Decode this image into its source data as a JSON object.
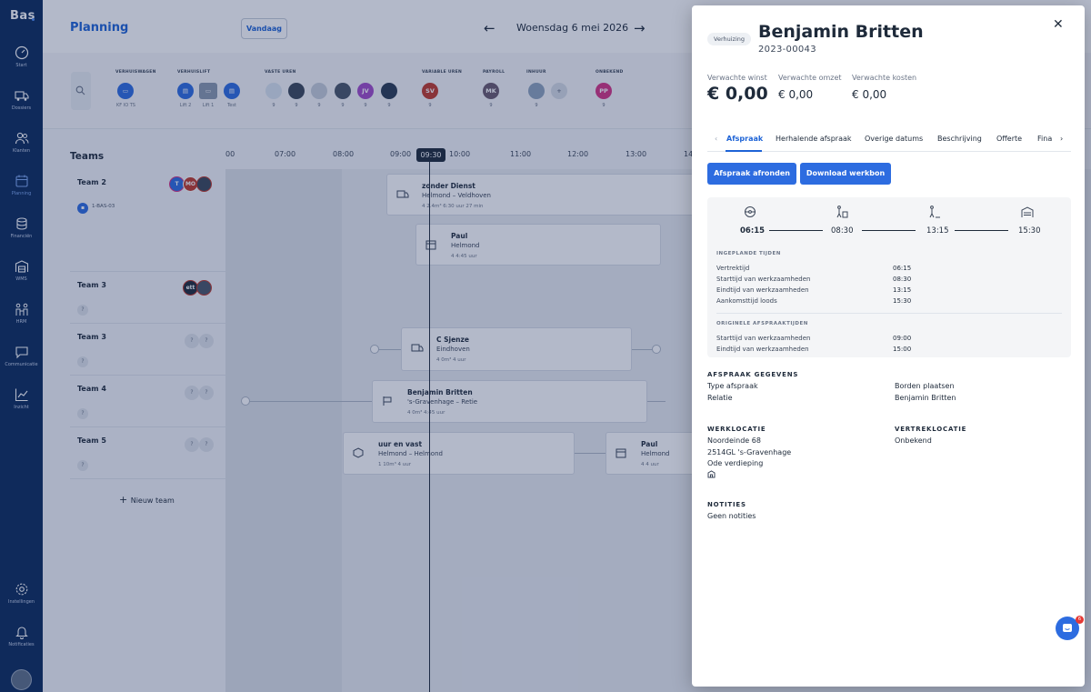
{
  "sidebar": {
    "logo": "Bas",
    "items": [
      {
        "label": "Start",
        "icon": "gauge-icon"
      },
      {
        "label": "Dossiers",
        "icon": "truck-icon"
      },
      {
        "label": "Klanten",
        "icon": "users-icon"
      },
      {
        "label": "Planning",
        "icon": "calendar-icon",
        "active": true
      },
      {
        "label": "Financiën",
        "icon": "coins-icon"
      },
      {
        "label": "WMS",
        "icon": "warehouse-icon"
      },
      {
        "label": "HRM",
        "icon": "people-icon"
      },
      {
        "label": "Communicatie",
        "icon": "chat-icon"
      },
      {
        "label": "Inzicht",
        "icon": "chart-icon"
      },
      {
        "label": "Instellingen",
        "icon": "gear-icon"
      },
      {
        "label": "Notificaties",
        "icon": "bell-icon"
      }
    ]
  },
  "header": {
    "title": "Planning",
    "today_button": "Vandaag",
    "date": "Woensdag 6 mei 2026"
  },
  "resources": {
    "groups": [
      "VERHUISWAGEN",
      "VERHUISLIFT",
      "VASTE UREN",
      "VARIABLE UREN",
      "PAYROLL",
      "INHUUR",
      "ONBEKEND"
    ],
    "items": [
      {
        "label": "KF IO TS",
        "initials": "",
        "color": "#2d6ce0"
      },
      {
        "label": "Lift 2",
        "initials": "",
        "color": "#2d6ce0"
      },
      {
        "label": "Lift 1",
        "initials": "",
        "color": "#8a98ad"
      },
      {
        "label": "Test",
        "initials": "",
        "color": "#2d6ce0"
      },
      {
        "label": "9",
        "initials": "",
        "color": "#d9e3ef"
      },
      {
        "label": "9",
        "initials": "",
        "color": "#3b4658"
      },
      {
        "label": "9",
        "initials": "",
        "color": "#c5cdd9"
      },
      {
        "label": "9",
        "initials": "",
        "color": "#4a5568"
      },
      {
        "label": "9",
        "initials": "JV",
        "color": "#a24bc8"
      },
      {
        "label": "9",
        "initials": "",
        "color": "#2b3b52"
      },
      {
        "label": "9",
        "initials": "SV",
        "color": "#c0392b"
      },
      {
        "label": "9",
        "initials": "MK",
        "color": "#6b5a6e"
      },
      {
        "label": "9",
        "initials": "",
        "color": "#8ea3bd"
      },
      {
        "label": "",
        "initials": "",
        "color": "#d5dbe4"
      },
      {
        "label": "9",
        "initials": "PP",
        "color": "#d63384"
      }
    ]
  },
  "teams": {
    "title": "Teams",
    "rows": [
      {
        "name": "Team 2",
        "tag": "1-BAS-03"
      },
      {
        "name": "Team 3",
        "tag": "?"
      },
      {
        "name": "Team 3",
        "tag": "?"
      },
      {
        "name": "Team 4",
        "tag": "?"
      },
      {
        "name": "Team 5",
        "tag": "?"
      }
    ],
    "new_team": "Nieuw team"
  },
  "timeline": {
    "ticks": [
      "00",
      "07:00",
      "08:00",
      "09:00",
      "10:00",
      "11:00",
      "12:00",
      "13:00",
      "14"
    ],
    "now": "09:30",
    "cards": [
      {
        "title": "zonder Dienst",
        "sub": "Helmond – Veldhoven",
        "meta": "4   2.4m³   6:30 uur   27 min"
      },
      {
        "title": "Paul",
        "sub": "Helmond",
        "meta": "4   4:45 uur"
      },
      {
        "title": "C Sjenze",
        "sub": "Eindhoven",
        "meta": "4   0m³   4 uur"
      },
      {
        "title": "Benjamin Britten",
        "sub": "'s-Gravenhage – Retie",
        "meta": "4   0m³   4:45 uur"
      },
      {
        "title": "uur en vast",
        "sub": "Helmond – Helmond",
        "meta": "1   10m³   4 uur"
      },
      {
        "title": "Paul",
        "sub": "Helmond",
        "meta": "4   4 uur"
      }
    ]
  },
  "panel": {
    "badge": "Verhuizing",
    "title": "Benjamin Britten",
    "subtitle": "2023-00043",
    "metrics": [
      {
        "label": "Verwachte winst",
        "value": "€ 0,00"
      },
      {
        "label": "Verwachte omzet",
        "value": "€ 0,00"
      },
      {
        "label": "Verwachte kosten",
        "value": "€ 0,00"
      }
    ],
    "tabs": [
      "Afspraak",
      "Herhalende afspraak",
      "Overige datums",
      "Beschrijving",
      "Offerte",
      "Fina"
    ],
    "buttons": {
      "complete": "Afspraak afronden",
      "download": "Download werkbon"
    },
    "timeline_times": [
      "06:15",
      "08:30",
      "13:15",
      "15:30"
    ],
    "planned_title": "INGEPLANDE TIJDEN",
    "planned": [
      {
        "label": "Vertrektijd",
        "value": "06:15"
      },
      {
        "label": "Starttijd van werkzaamheden",
        "value": "08:30"
      },
      {
        "label": "Eindtijd van werkzaamheden",
        "value": "13:15"
      },
      {
        "label": "Aankomsttijd loods",
        "value": "15:30"
      }
    ],
    "original_title": "ORIGINELE AFSPRAAKTIJDEN",
    "original": [
      {
        "label": "Starttijd van werkzaamheden",
        "value": "09:00"
      },
      {
        "label": "Eindtijd van werkzaamheden",
        "value": "15:00"
      }
    ],
    "details_title": "AFSPRAAK GEGEVENS",
    "details": [
      {
        "label": "Type afspraak",
        "value": "Borden plaatsen"
      },
      {
        "label": "Relatie",
        "value": "Benjamin Britten"
      }
    ],
    "werklocatie_title": "WERKLOCATIE",
    "werklocatie": [
      "Noordeinde 68",
      "2514GL 's-Gravenhage",
      "Ode verdieping"
    ],
    "vertrek_title": "VERTREKLOCATIE",
    "vertrek": "Onbekend",
    "notes_title": "NOTITIES",
    "notes": "Geen notities"
  },
  "chat": {
    "badge": "6"
  },
  "colors": {
    "primary": "#2d6ce0",
    "sidebar": "#0b2a5b",
    "overlay": "rgba(24,42,92,0.33)"
  }
}
